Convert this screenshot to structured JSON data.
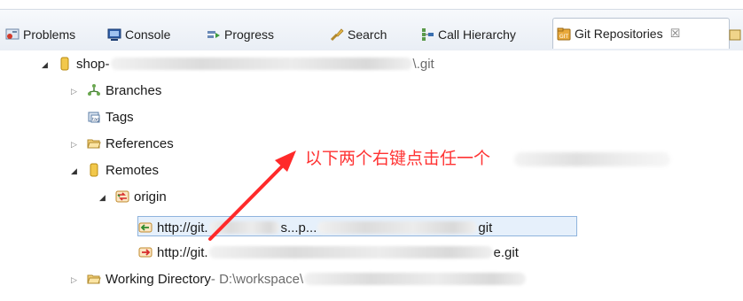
{
  "tabs": [
    {
      "label": "Problems",
      "icon": "problems-icon",
      "active": false
    },
    {
      "label": "Console",
      "icon": "console-icon",
      "active": false
    },
    {
      "label": "Progress",
      "icon": "progress-icon",
      "active": false
    },
    {
      "label": "Search",
      "icon": "search-icon",
      "active": false
    },
    {
      "label": "Call Hierarchy",
      "icon": "call-hierarchy-icon",
      "active": false
    },
    {
      "label": "Git Repositories",
      "icon": "git-repositories-icon",
      "active": true,
      "close": "☒"
    }
  ],
  "tree": {
    "repo": {
      "name_prefix": "shop-",
      "path_suffix": "\\.git"
    },
    "branches": "Branches",
    "tags": "Tags",
    "references": "References",
    "remotes": "Remotes",
    "origin": "origin",
    "fetch_url": {
      "prefix": "http://git.",
      "mid": "s...p...",
      "suffix": "git"
    },
    "push_url": {
      "prefix": "http://git.",
      "suffix": "e.git"
    },
    "working_directory": {
      "label": "Working Directory",
      "path_prefix": " - D:\\workspace\\"
    }
  },
  "annotation": {
    "text": "以下两个右键点击任一个",
    "color": "#ff3333"
  },
  "colors": {
    "selection": "#e6f0fb",
    "selection_border": "#8fb4dd",
    "annotation_arrow": "#ff2222"
  }
}
